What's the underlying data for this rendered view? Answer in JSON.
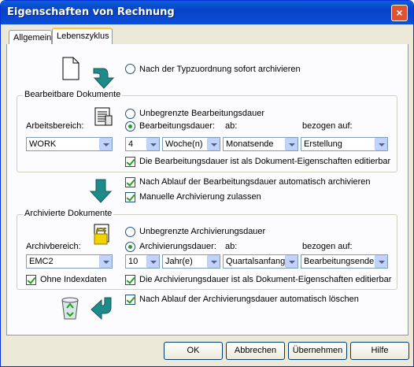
{
  "window": {
    "title": "Eigenschaften von Rechnung",
    "close_glyph": "×"
  },
  "tabs": [
    {
      "label": "Allgemein"
    },
    {
      "label": "Lebenszyklus"
    }
  ],
  "top": {
    "archive_now_label": "Nach der Typzuordnung sofort archivieren"
  },
  "editable": {
    "group_label": "Bearbeitbare Dokumente",
    "area_label": "Arbeitsbereich:",
    "area_value": "WORK",
    "unlimited_label": "Unbegrenzte Bearbeitungsdauer",
    "duration_label": "Bearbeitungsdauer:",
    "ab_label": "ab:",
    "ref_label": "bezogen auf:",
    "num_value": "4",
    "unit_value": "Woche(n)",
    "from_value": "Monatsende",
    "ref_value": "Erstellung",
    "editable_check_label": "Die Bearbeitungsdauer ist als Dokument-Eigenschaften editierbar"
  },
  "middle": {
    "auto_archive_label": "Nach Ablauf der Bearbeitungsdauer automatisch archivieren",
    "manual_label": "Manuelle Archivierung zulassen"
  },
  "archived": {
    "group_label": "Archivierte Dokumente",
    "area_label": "Archivbereich:",
    "area_value": "EMC2",
    "unlimited_label": "Unbegrenzte Archivierungsdauer",
    "duration_label": "Archivierungsdauer:",
    "ab_label": "ab:",
    "ref_label": "bezogen auf:",
    "num_value": "10",
    "unit_value": "Jahr(e)",
    "from_value": "Quartalsanfang",
    "ref_value": "Bearbeitungsende",
    "noindex_label": "Ohne Indexdaten",
    "editable_check_label": "Die Archivierungsdauer ist als Dokument-Eigenschaften editierbar"
  },
  "bottom": {
    "auto_delete_label": "Nach Ablauf der Archivierungsdauer automatisch löschen"
  },
  "buttons": {
    "ok": "OK",
    "cancel": "Abbrechen",
    "apply": "Übernehmen",
    "help": "Hilfe"
  },
  "colors": {
    "arrow": "#1f8a8a",
    "titlebar": "#0842c7",
    "check": "#21a121"
  }
}
